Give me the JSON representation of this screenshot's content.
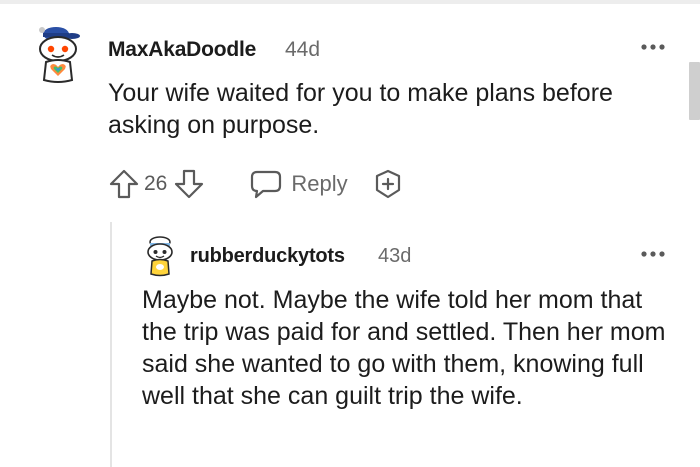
{
  "comment": {
    "username": "MaxAkaDoodle",
    "age": "44d",
    "text": "Your wife waited for you to make plans before asking on purpose.",
    "score": "26",
    "reply_label": "Reply",
    "avatar_icon": "snoo-avatar-blue-cap-icon",
    "more_icon": "more-options-icon"
  },
  "reply": {
    "username": "rubberduckytots",
    "age": "43d",
    "text": "Maybe not. Maybe the wife told her mom that the trip was paid for and settled. Then her mom said she wanted to go with them, knowing full well that she can guilt trip the wife.",
    "avatar_icon": "snoo-avatar-white-hat-icon",
    "more_icon": "more-options-icon"
  },
  "colors": {
    "text": "#1c1c1c",
    "meta": "#6a6a6a",
    "icon": "#5a5a5a",
    "thread_line": "#e4e4e4"
  }
}
